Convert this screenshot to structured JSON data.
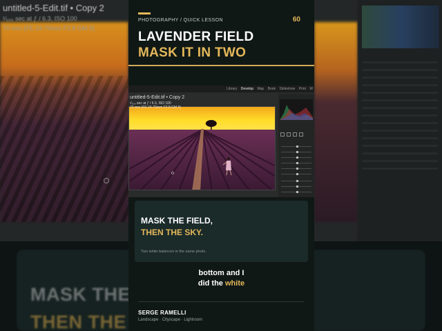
{
  "background": {
    "file_title": "untitled-5-Edit.tif",
    "file_copy": "Copy 2",
    "exif_line": "¹⁄₅₀₀ sec at ƒ / 6.3, ISO 100",
    "lens_line": "70 mm (FE 24-70mm F2.8 GM II)",
    "big_line_1": "MASK THE",
    "big_line_2": "THEN THE S"
  },
  "header": {
    "kicker": "PHOTOGRAPHY / QUICK LESSON",
    "page_number": "60",
    "title_line_1": "LAVENDER FIELD",
    "title_line_2": "MASK IT IN TWO"
  },
  "lightroom": {
    "modules": [
      "Library",
      "Develop",
      "Map",
      "Book",
      "Slideshow",
      "Print",
      "W"
    ],
    "active_module": "Develop",
    "photo_title": "untitled-5-Edit.tif  •  Copy 2",
    "exif": "¹⁄₅₀₀ sec at ƒ / 6.3, ISO 100",
    "lens": "70 mm (FE 24-70mm F2.8 GM II)"
  },
  "text_card": {
    "line_1": "MASK THE FIELD,",
    "line_2": "THEN THE SKY.",
    "note": "Two white balances in the same photo."
  },
  "caption": {
    "line_1": "bottom and I",
    "line_2_prefix": "did the ",
    "line_2_highlight": "white"
  },
  "footer": {
    "author": "SERGE RAMELLI",
    "tags": "Landscape · Cityscape · Lightroom"
  },
  "colors": {
    "accent": "#e4b85a",
    "card_bg": "#101816",
    "text_card_bg": "#1b2b2a"
  }
}
